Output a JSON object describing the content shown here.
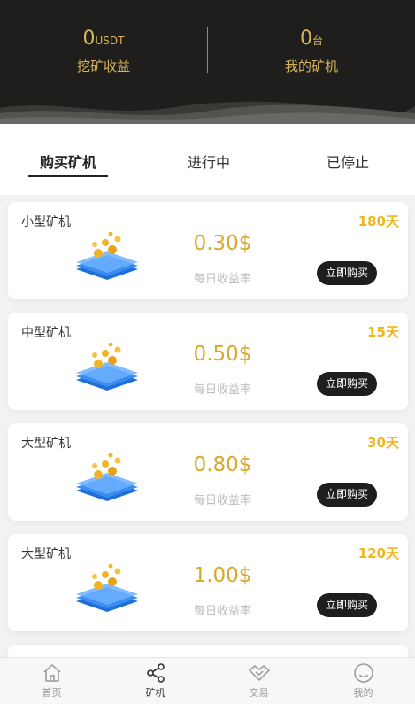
{
  "header": {
    "mining_income": {
      "value": "0",
      "unit": "USDT",
      "label": "挖矿收益"
    },
    "my_miners": {
      "value": "0",
      "unit": "台",
      "label": "我的矿机"
    }
  },
  "tabs": [
    {
      "label": "购买矿机",
      "active": true
    },
    {
      "label": "进行中",
      "active": false
    },
    {
      "label": "已停止",
      "active": false
    }
  ],
  "miners": [
    {
      "name": "小型矿机",
      "duration": "180天",
      "rate": "0.30$",
      "rate_label": "每日收益率",
      "buy_label": "立即购买"
    },
    {
      "name": "中型矿机",
      "duration": "15天",
      "rate": "0.50$",
      "rate_label": "每日收益率",
      "buy_label": "立即购买"
    },
    {
      "name": "大型矿机",
      "duration": "30天",
      "rate": "0.80$",
      "rate_label": "每日收益率",
      "buy_label": "立即购买"
    },
    {
      "name": "大型矿机",
      "duration": "120天",
      "rate": "1.00$",
      "rate_label": "每日收益率",
      "buy_label": "立即购买"
    }
  ],
  "bottom_nav": [
    {
      "label": "首页",
      "icon": "home-icon",
      "active": false
    },
    {
      "label": "矿机",
      "icon": "share-nodes-icon",
      "active": true
    },
    {
      "label": "交易",
      "icon": "handshake-icon",
      "active": false
    },
    {
      "label": "我的",
      "icon": "smile-face-icon",
      "active": false
    }
  ],
  "colors": {
    "header_bg": "#1f1e1c",
    "gold_text": "#d8b45a",
    "duration_yellow": "#f2b61c",
    "rate_gold": "#d9a82e",
    "button_bg": "#1f1e1c"
  }
}
